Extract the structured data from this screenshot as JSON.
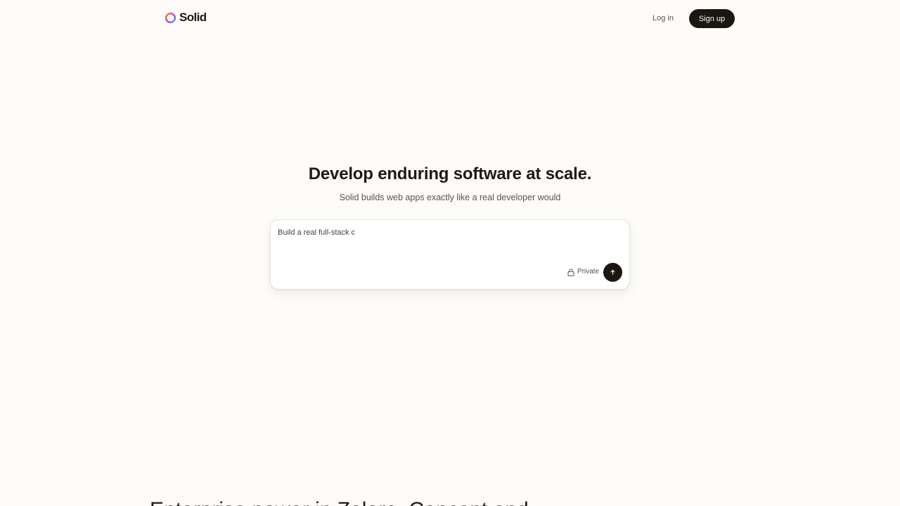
{
  "header": {
    "logo_text": "Solid",
    "login_label": "Log in",
    "signup_label": "Sign up"
  },
  "hero": {
    "title": "Develop enduring software at scale.",
    "subtitle": "Solid builds web apps exactly like a real developer would"
  },
  "prompt": {
    "value": "Build a real full-stack c",
    "private_label": "Private",
    "icons": {
      "privacy": "lock-icon",
      "submit": "arrow-up-icon"
    }
  },
  "section": {
    "heading": "Enterprise power in Zalore. Concept and"
  },
  "colors": {
    "background": "#fefcf8",
    "text": "#1c1917",
    "muted": "#57534e",
    "button_dark": "#1c1611",
    "logo_gradient": [
      "#f59e0b",
      "#ec4899",
      "#8b5cf6",
      "#38bdf8"
    ]
  }
}
